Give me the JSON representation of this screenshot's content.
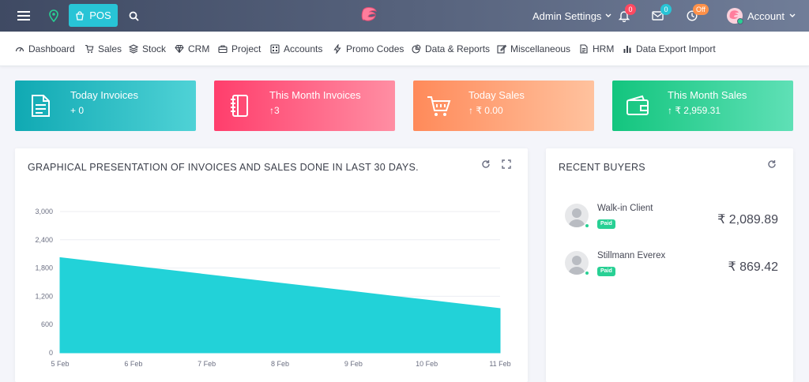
{
  "topbar": {
    "pos_label": "POS",
    "admin_label": "Admin Settings",
    "notifications_count": "0",
    "messages_count": "0",
    "clock_badge": "Off",
    "account_label": "Account"
  },
  "nav": {
    "items": [
      {
        "label": "Dashboard",
        "icon": "dashboard-icon"
      },
      {
        "label": "Sales",
        "icon": "cart-icon"
      },
      {
        "label": "Stock",
        "icon": "layers-icon"
      },
      {
        "label": "CRM",
        "icon": "diamond-icon"
      },
      {
        "label": "Project",
        "icon": "briefcase-icon"
      },
      {
        "label": "Accounts",
        "icon": "calculator-icon"
      },
      {
        "label": "Promo Codes",
        "icon": "bolt-icon"
      },
      {
        "label": "Data & Reports",
        "icon": "pie-icon"
      },
      {
        "label": "Miscellaneous",
        "icon": "edit-icon"
      },
      {
        "label": "HRM",
        "icon": "file-icon"
      },
      {
        "label": "Data Export Import",
        "icon": "bar-chart-icon"
      }
    ]
  },
  "cards": [
    {
      "label": "Today Invoices",
      "value": "+ 0",
      "icon": "document-icon"
    },
    {
      "label": "This Month Invoices",
      "value": "↑3",
      "icon": "notebook-icon"
    },
    {
      "label": "Today Sales",
      "value": "↑ ₹ 0.00",
      "icon": "basket-icon"
    },
    {
      "label": "This Month Sales",
      "value": "↑ ₹ 2,959.31",
      "icon": "wallet-icon"
    }
  ],
  "chart_panel": {
    "title": "GRAPHICAL PRESENTATION OF INVOICES AND SALES DONE IN LAST 30 DAYS."
  },
  "chart_data": {
    "type": "area",
    "x": [
      "5 Feb",
      "6 Feb",
      "7 Feb",
      "8 Feb",
      "9 Feb",
      "10 Feb",
      "11 Feb"
    ],
    "values": [
      2020,
      1840,
      1660,
      1480,
      1300,
      1120,
      940
    ],
    "yticks": [
      "0",
      "600",
      "1,200",
      "1,800",
      "2,400",
      "3,000"
    ],
    "ylim": [
      0,
      3000
    ],
    "grid": true,
    "color": "#22d2d8"
  },
  "buyers_panel": {
    "title": "RECENT BUYERS",
    "buyers": [
      {
        "name": "Walk-in Client",
        "status": "Paid",
        "amount": "₹ 2,089.89"
      },
      {
        "name": "Stillmann Everex",
        "status": "Paid",
        "amount": "₹ 869.42"
      }
    ]
  },
  "colors": {
    "accent": "#28c4d6",
    "paid": "#28d094"
  }
}
